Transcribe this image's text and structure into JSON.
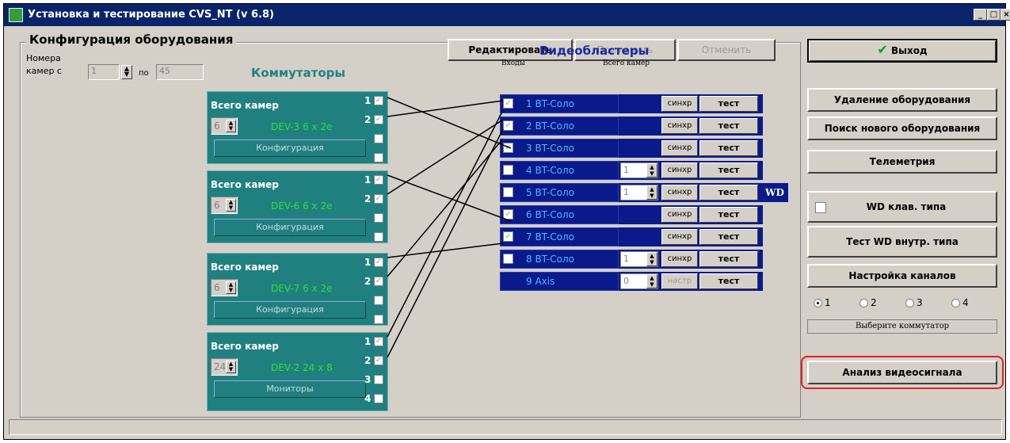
{
  "window": {
    "title": "Установка и тестирование CVS_NT (v 6.8)",
    "min": "_",
    "max": "□",
    "close": "×"
  },
  "config": {
    "title": "Конфигурация оборудования",
    "cam_label_1": "Номера",
    "cam_label_2": "камер с",
    "cam_from": "1",
    "cam_to_label": "по",
    "cam_to": "45"
  },
  "toolbar": {
    "edit": "Редактировать",
    "apply": "Применить",
    "cancel": "Отменить",
    "exit": "Выход"
  },
  "switches": {
    "heading": "Коммутаторы",
    "items": [
      {
        "title": "Всего камер",
        "count": "6",
        "dev": "DEV-3  6 x 2e",
        "button": "Конфигурация",
        "ports": [
          "1",
          "2",
          "",
          ""
        ]
      },
      {
        "title": "Всего камер",
        "count": "6",
        "dev": "DEV-6  6 x 2e",
        "button": "Конфигурация",
        "ports": [
          "1",
          "2",
          "",
          ""
        ]
      },
      {
        "title": "Всего камер",
        "count": "6",
        "dev": "DEV-7  6 x 2e",
        "button": "Конфигурация",
        "ports": [
          "1",
          "2",
          "",
          ""
        ]
      },
      {
        "title": "Всего камер",
        "count": "24",
        "dev": "DEV-2  24 x 8",
        "button": "Мониторы",
        "ports": [
          "1",
          "2",
          "3",
          "4"
        ]
      }
    ]
  },
  "blasters": {
    "heading": "Видеобластеры",
    "inputs_label": "Входы",
    "total_label": "Всего камер",
    "rows": [
      {
        "name": "1  BT-Соло",
        "checked": true,
        "count": "",
        "sync": "синхр",
        "test": "тест",
        "wd": ""
      },
      {
        "name": "2  BT-Соло",
        "checked": true,
        "count": "",
        "sync": "синхр",
        "test": "тест",
        "wd": ""
      },
      {
        "name": "3  BT-Соло",
        "checked": true,
        "count": "",
        "sync": "синхр",
        "test": "тест",
        "wd": ""
      },
      {
        "name": "4  BT-Соло",
        "checked": false,
        "count": "1",
        "sync": "синхр",
        "test": "тест",
        "wd": ""
      },
      {
        "name": "5  BT-Соло",
        "checked": false,
        "count": "1",
        "sync": "синхр",
        "test": "тест",
        "wd": "WD"
      },
      {
        "name": "6  BT-Соло",
        "checked": true,
        "count": "",
        "sync": "синхр",
        "test": "тест",
        "wd": ""
      },
      {
        "name": "7  BT-Соло",
        "checked": true,
        "count": "",
        "sync": "синхр",
        "test": "тест",
        "wd": ""
      },
      {
        "name": "8  BT-Соло",
        "checked": false,
        "count": "1",
        "sync": "синхр",
        "test": "тест",
        "wd": ""
      },
      {
        "name": "9  Axis",
        "checked": null,
        "count": "0",
        "sync": "настр",
        "test": "тест",
        "wd": ""
      }
    ]
  },
  "right": {
    "remove": "Удаление оборудования",
    "search": "Поиск нового оборудования",
    "telemetry": "Телеметрия",
    "wd_keyboard": "WD клав. типа",
    "wd_internal": "Тест WD внутр. типа",
    "channels": "Настройка каналов",
    "radios": [
      "1",
      "2",
      "3",
      "4"
    ],
    "selected_radio": "1",
    "select_switch": "Выберите коммутатор",
    "analysis": "Анализ видеосигнала"
  },
  "colors": {
    "titlebar": "#0a246a",
    "switch": "#208080",
    "blaster": "#0a1a8a",
    "highlight": "#e02020"
  }
}
